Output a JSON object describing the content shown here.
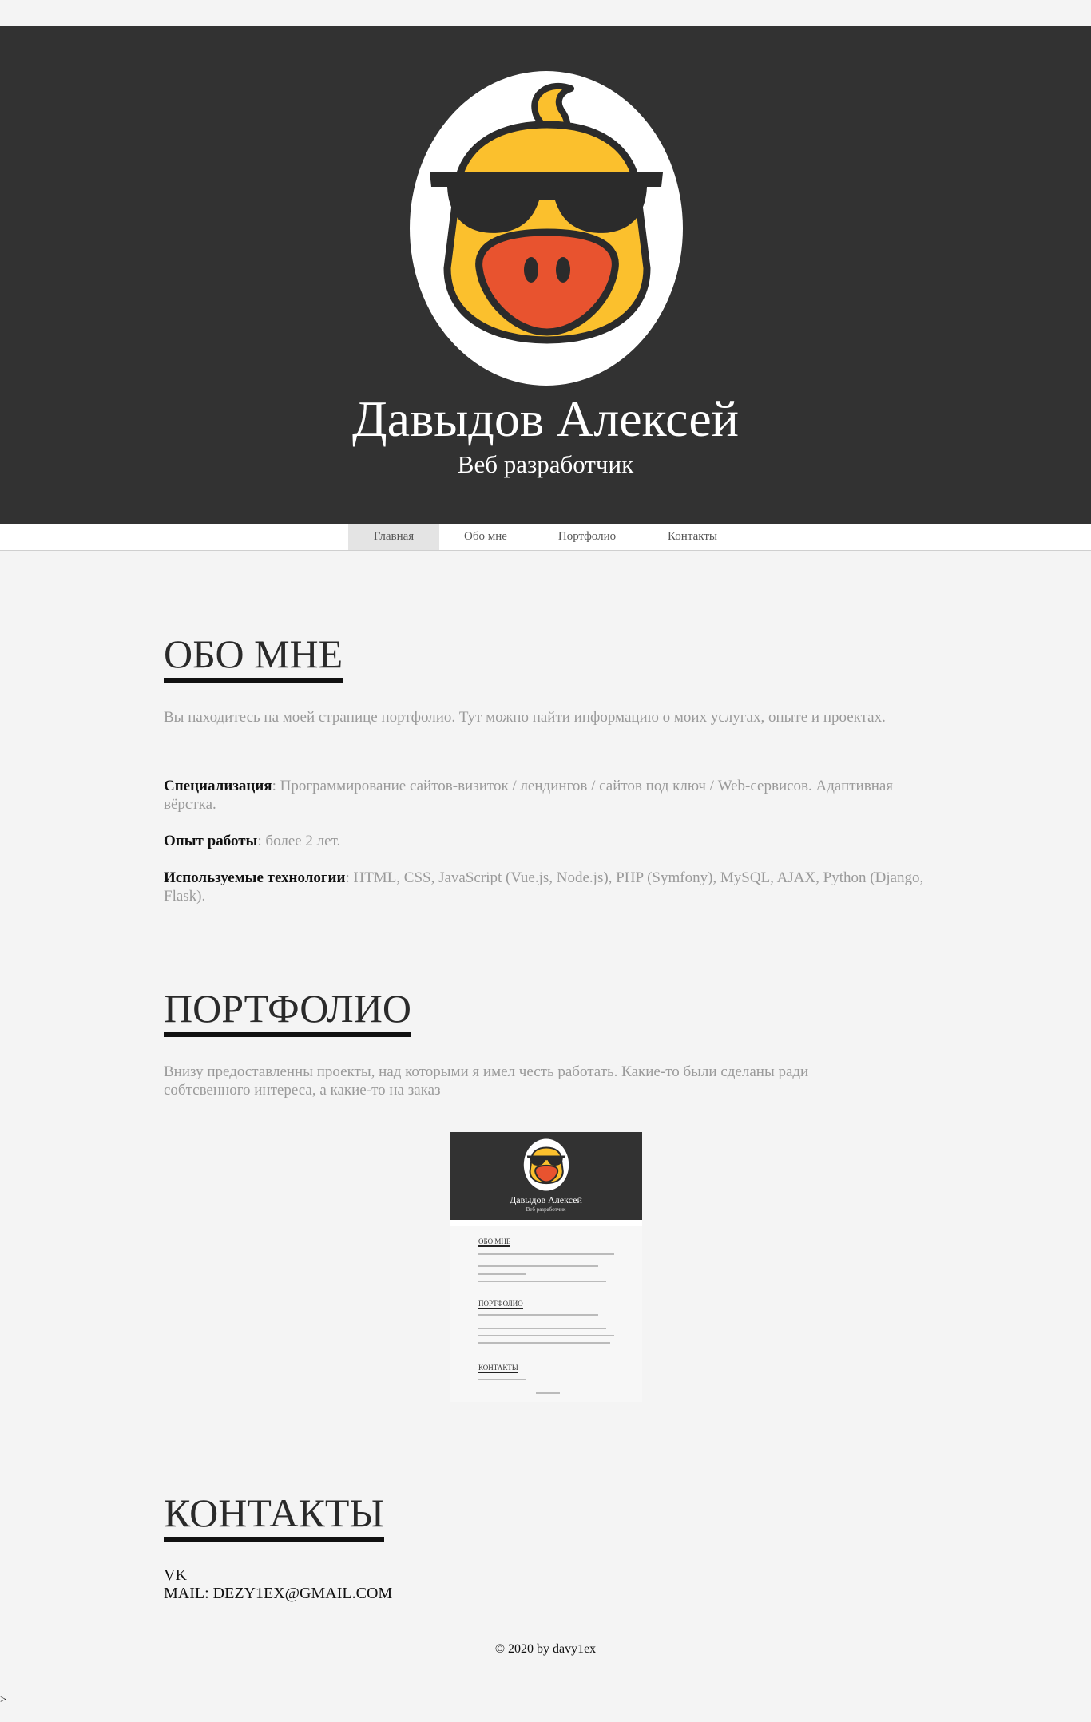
{
  "header": {
    "name": "Давыдов Алексей",
    "role": "Веб разработчик",
    "avatar_icon": "duck-sunglasses-icon"
  },
  "nav": {
    "items": [
      {
        "label": "Главная",
        "active": true
      },
      {
        "label": "Обо мне",
        "active": false
      },
      {
        "label": "Портфолио",
        "active": false
      },
      {
        "label": "Контакты",
        "active": false
      }
    ]
  },
  "about": {
    "title": "ОБО МНЕ",
    "intro": "Вы находитесь на моей странице портфолио. Тут можно найти информацию о моих услугах, опыте и проектах.",
    "spec_label": "Специализация",
    "spec_text": ": Программирование сайтов-визиток / лендингов / сайтов под ключ / Web-сервисов. Адаптивная вёрстка.",
    "exp_label": "Опыт работы",
    "exp_text": ": более 2 лет.",
    "tech_label": "Используемые технологии",
    "tech_text": ": HTML, CSS, JavaScript (Vue.js, Node.js), PHP (Symfony), MySQL, AJAX, Python (Django, Flask)."
  },
  "portfolio": {
    "title": "ПОРТФОЛИО",
    "intro": "Внизу предоставленны проекты, над которыми я имел честь работать. Какие-то были сделаны ради собтсвенного интереса, а какие-то на заказ",
    "thumb": {
      "name": "Давыдов Алексей",
      "role": "Веб разработчик",
      "h1": "ОБО МНЕ",
      "h2": "ПОРТФОЛИО",
      "h3": "КОНТАКТЫ"
    }
  },
  "contacts": {
    "title": "КОНТАКТЫ",
    "vk": "VK",
    "mail": "MAIL: DEZY1EX@GMAIL.COM"
  },
  "footer": {
    "text": "© 2020 by davy1ex"
  },
  "corner": ">",
  "colors": {
    "header_bg": "#323232",
    "page_bg": "#f4f4f4",
    "duck_yellow": "#fbc02d",
    "duck_beak": "#e8532f"
  }
}
